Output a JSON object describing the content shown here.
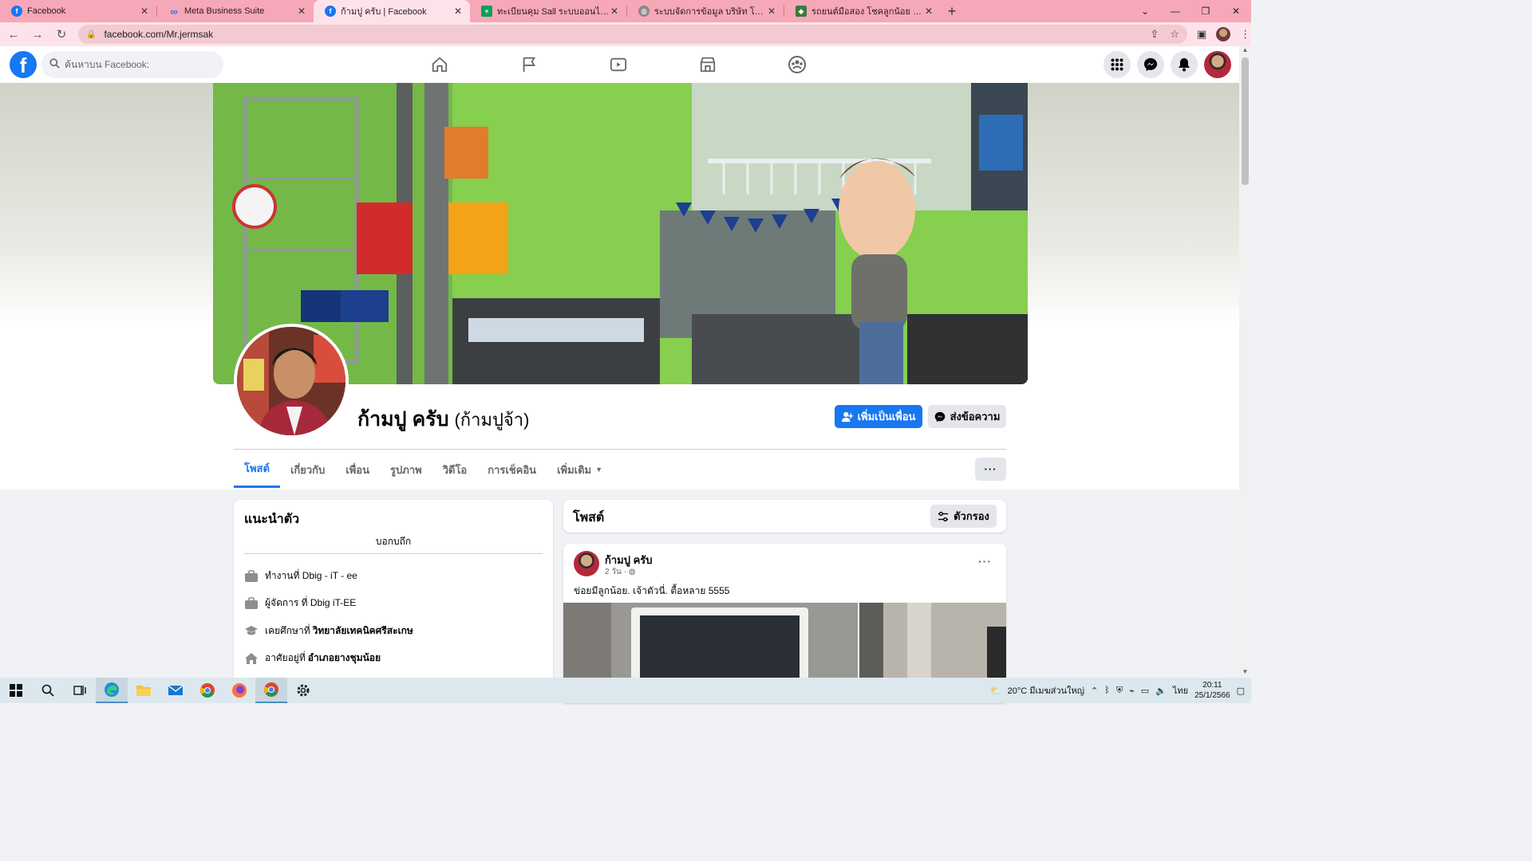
{
  "browser": {
    "tabs": [
      {
        "title": "Facebook",
        "favicon": "facebook-icon",
        "active": false
      },
      {
        "title": "Meta Business Suite",
        "favicon": "meta-icon",
        "active": false
      },
      {
        "title": "ก้ามปู ครับ | Facebook",
        "favicon": "facebook-icon",
        "active": true
      },
      {
        "title": "ทะเบียนคุม Sall ระบบออนไลน์.xlsx - G",
        "favicon": "sheets-icon",
        "active": false
      },
      {
        "title": "ระบบจัดการข้อมูล บริษัท โชคลูกน้อย",
        "favicon": "globe-icon",
        "active": false
      },
      {
        "title": "รถยนต์มือสอง โชคลูกน้อย อุดรธานี",
        "favicon": "site-icon",
        "active": false
      }
    ],
    "new_tab": "+",
    "url": "facebook.com/Mr.jermsak"
  },
  "fb_header": {
    "logo": "f",
    "search_placeholder": "ค้นหาบน Facebook:",
    "nav_icons": [
      "home-icon",
      "pages-flag-icon",
      "watch-video-icon",
      "marketplace-icon",
      "groups-icon"
    ],
    "right_icons": [
      "menu-grid-icon",
      "messenger-icon",
      "notifications-bell-icon",
      "account-avatar"
    ]
  },
  "profile": {
    "name": "ก้ามปู ครับ",
    "alt_name": "(ก้ามปูจ้า)",
    "add_friend_label": "เพิ่มเป็นเพื่อน",
    "message_label": "ส่งข้อความ",
    "tabs": [
      {
        "label": "โพสต์",
        "active": true
      },
      {
        "label": "เกี่ยวกับ",
        "active": false
      },
      {
        "label": "เพื่อน",
        "active": false
      },
      {
        "label": "รูปภาพ",
        "active": false
      },
      {
        "label": "วิดีโอ",
        "active": false
      },
      {
        "label": "การเช็คอิน",
        "active": false
      },
      {
        "label": "เพิ่มเติม",
        "active": false
      }
    ],
    "more_label": "···"
  },
  "intro": {
    "title": "แนะนำตัว",
    "subtitle": "บอกบถึก",
    "items": [
      {
        "icon": "briefcase-icon",
        "text": "ทำงานที่ Dbig - iT - ee",
        "bold": ""
      },
      {
        "icon": "briefcase-icon",
        "text": "ผู้จัดการ ที่ Dbig iT-EE",
        "bold": ""
      },
      {
        "icon": "graduation-cap-icon",
        "text": "เคยศึกษาที่",
        "bold": "วิทยาลัยเทคนิคศรีสะเกษ"
      },
      {
        "icon": "house-icon",
        "text": "อาศัยอยู่ที่",
        "bold": "อำเภอยางชุมน้อย"
      }
    ]
  },
  "posts": {
    "title": "โพสต์",
    "filter_label": "ตัวกรอง",
    "post": {
      "author": "ก้ามปู ครับ",
      "time": "2 วัน ·",
      "text": "ข่อยมีลูกน้อย.  เจ้าตัวนี่. ตื้อหลาย 5555",
      "options": "···"
    }
  },
  "taskbar": {
    "weather": "20°C  มีเมฆส่วนใหญ่",
    "lang": "ไทย",
    "time": "20:11",
    "date": "25/1/2566"
  },
  "colors": {
    "fb_blue": "#1877f2",
    "tab_strip": "#f7a8b8",
    "page_bg": "#f0f2f5"
  }
}
